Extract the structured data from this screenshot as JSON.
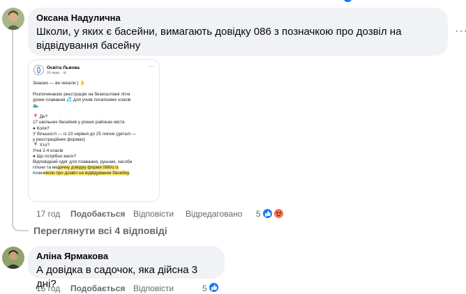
{
  "comments": [
    {
      "author": "Оксана Надулична",
      "text_line1": "Школи, у яких є басейни, вимагають довідку 086 з позначкою про дозвіл на",
      "text_line2": "відвідування басейну",
      "time": "17 год",
      "like_label": "Подобається",
      "reply_label": "Відповісти",
      "edited_label": "Відредаговано",
      "reaction_count": "5",
      "reactions": [
        "like-icon",
        "angry-icon"
      ],
      "embedded_post": {
        "page_name": "Освіта Львова",
        "date": "16 черв. · ",
        "lines": [
          "Знаємо — ви чекали:) 👌",
          "",
          "Розпочинаємо реєстрацію на безкоштовні літні",
          "уроки плавання 💦 для учнів початкових класів",
          "🏊",
          "",
          "📍 Де?",
          "17 шкільних басейнів у різних районах міста",
          "● Коли?",
          "У більшості — із 23 червня до 25 липня (деталі —",
          "у реєстраційних формах)",
          "📍 Хто?",
          "Учні 2-4 класів",
          "● Що потрібно мати?",
          "Відповідний одяг для плавання, рушник, засоби"
        ],
        "line_hl1_plain": "гігієни та ме",
        "line_hl1_mark": "дичну довідку форми 086/о із",
        "line_hl2_plain": "позна",
        "line_hl2_mark": "чкою про дозвіл на відвідування басейну",
        "line_hl2_tail": "."
      }
    },
    {
      "author": "Аліна Ярмакова",
      "text_line1": "А довідка в садочок, яка дійсна 3 дні?",
      "time": "15 год",
      "like_label": "Подобається",
      "reply_label": "Відповісти",
      "reaction_count": "5",
      "reactions": [
        "like-icon"
      ]
    }
  ],
  "view_replies_label": "Переглянути всі 4 відповіді",
  "more_label": "···",
  "colors": {
    "like": "#1877f2",
    "angry": "#f7714c",
    "meta": "#65676b",
    "bubble": "#f0f2f5",
    "thread": "#ced0d4"
  }
}
